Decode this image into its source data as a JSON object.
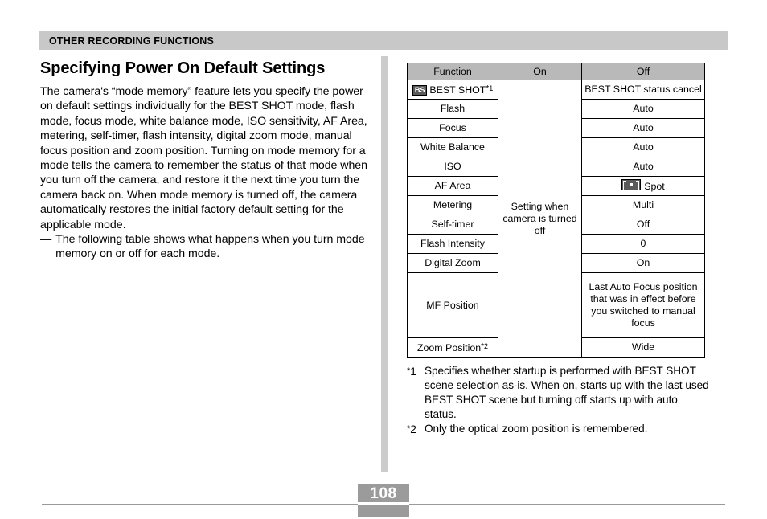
{
  "header": {
    "chapter_title": "OTHER RECORDING FUNCTIONS"
  },
  "left_column": {
    "title": "Specifying Power On Default Settings",
    "paragraph": "The camera's “mode memory” feature lets you specify the power on default settings individually for the BEST SHOT mode, flash mode, focus mode, white balance mode, ISO sensitivity, AF Area, metering, self-timer, flash intensity, digital zoom mode, manual focus position and zoom position. Turning on mode memory for a mode tells the camera to remember the status of that mode when you turn off the camera, and restore it the next time you turn the camera back on. When mode memory is turned off, the camera automatically restores the initial factory default setting for the applicable mode.",
    "dash_marker": "—",
    "dash_item": "The following table shows what happens when you turn mode memory on or off for each mode."
  },
  "table": {
    "headers": {
      "function": "Function",
      "on": "On",
      "off": "Off"
    },
    "on_merged_text": "Setting when camera is turned off",
    "rows": [
      {
        "function_icon": "bs-badge",
        "function_icon_label": "BS",
        "function": "BEST SHOT",
        "function_footnote": "1",
        "off": "BEST SHOT status cancel",
        "off_style": "wrap"
      },
      {
        "function": "Flash",
        "off": "Auto"
      },
      {
        "function": "Focus",
        "off": "Auto"
      },
      {
        "function": "White Balance",
        "off": "Auto"
      },
      {
        "function": "ISO",
        "off": "Auto"
      },
      {
        "function": "AF Area",
        "off_icon": "spot-icon",
        "off": "Spot"
      },
      {
        "function": "Metering",
        "off": "Multi"
      },
      {
        "function": "Self-timer",
        "off": "Off"
      },
      {
        "function": "Flash Intensity",
        "off": "0"
      },
      {
        "function": "Digital Zoom",
        "off": "On"
      },
      {
        "function": "MF Position",
        "off": "Last Auto Focus position that was in effect before you switched to manual focus",
        "off_style": "left-tall"
      },
      {
        "function": "Zoom Position",
        "function_footnote": "2",
        "off": "Wide"
      }
    ]
  },
  "footnotes": [
    {
      "asterisk": "*",
      "number": "1",
      "text": "Specifies whether startup is performed with BEST SHOT scene selection as-is. When on, starts up with the last used BEST SHOT scene but turning off starts up with auto status."
    },
    {
      "asterisk": "*",
      "number": "2",
      "text": "Only the optical zoom position is remembered."
    }
  ],
  "footer": {
    "page_number": "108"
  },
  "colors": {
    "header_band": "#c8c8c8",
    "table_header": "#b9b9b9",
    "divider": "#cccccc",
    "page_number_box": "#9b9b9b",
    "icon_fill": "#5a5a5a"
  }
}
